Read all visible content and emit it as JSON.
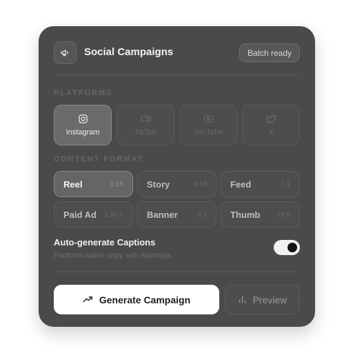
{
  "header": {
    "title": "Social Campaigns",
    "status_badge": "Batch ready",
    "icon": "megaphone-icon"
  },
  "platforms": {
    "label": "PLATFORMS",
    "items": [
      {
        "label": "Instagram",
        "icon": "instagram-icon",
        "selected": true
      },
      {
        "label": "TikTok",
        "icon": "video-camera-icon",
        "selected": false
      },
      {
        "label": "YouTube",
        "icon": "youtube-icon",
        "selected": false
      },
      {
        "label": "X",
        "icon": "twitter-bird-icon",
        "selected": false
      }
    ]
  },
  "content_format": {
    "label": "CONTENT FORMAT",
    "items": [
      {
        "name": "Reel",
        "ratio": "9:16",
        "selected": true
      },
      {
        "name": "Story",
        "ratio": "9:16",
        "selected": false
      },
      {
        "name": "Feed",
        "ratio": "1:1",
        "selected": false
      },
      {
        "name": "Paid Ad",
        "ratio": "1.91:1",
        "selected": false
      },
      {
        "name": "Banner",
        "ratio": "3:1",
        "selected": false
      },
      {
        "name": "Thumb",
        "ratio": "16:9",
        "selected": false
      }
    ]
  },
  "captions": {
    "title": "Auto-generate Captions",
    "subtitle": "Platform-native copy with hashtags",
    "enabled": true
  },
  "actions": {
    "generate_label": "Generate Campaign",
    "generate_icon": "trending-up-icon",
    "preview_label": "Preview",
    "preview_icon": "bar-chart-icon"
  },
  "colors": {
    "card_background": "#4a4a4a",
    "primary_button": "#ffffff",
    "toggle_on": "#f2f2f2"
  }
}
